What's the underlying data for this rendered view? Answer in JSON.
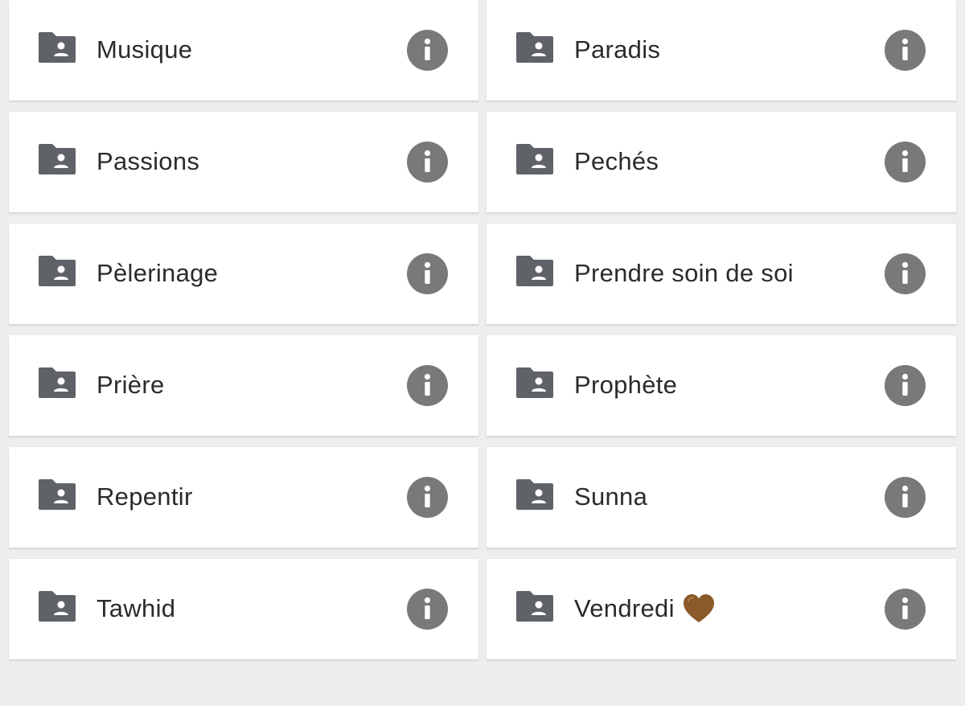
{
  "folders": [
    {
      "name": "Musique"
    },
    {
      "name": "Paradis"
    },
    {
      "name": "Passions"
    },
    {
      "name": "Pechés"
    },
    {
      "name": "Pèlerinage"
    },
    {
      "name": "Prendre soin de soi"
    },
    {
      "name": "Prière"
    },
    {
      "name": "Prophète"
    },
    {
      "name": "Repentir"
    },
    {
      "name": "Sunna"
    },
    {
      "name": "Tawhid"
    },
    {
      "name": "Vendredi",
      "emoji": "brown-heart-icon"
    }
  ],
  "colors": {
    "background": "#eeeeee",
    "card": "#ffffff",
    "icon": "#5f6368",
    "info": "#78797b",
    "text": "#2b2b2d",
    "heart": "#8b5a2b"
  },
  "icons": {
    "folder": "shared-folder-icon",
    "info": "info-icon"
  }
}
